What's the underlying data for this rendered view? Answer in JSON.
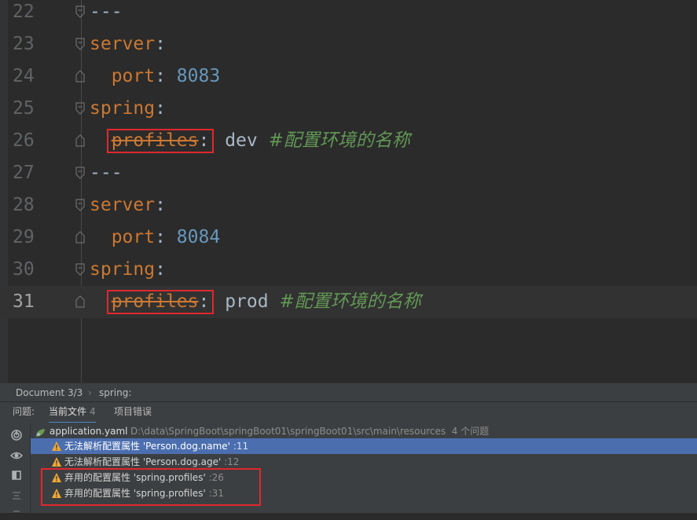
{
  "editor": {
    "lines": [
      {
        "num": "22",
        "indent": "",
        "tokens": [
          {
            "t": "---",
            "c": "p"
          }
        ]
      },
      {
        "num": "23",
        "indent": "",
        "tokens": [
          {
            "t": "server",
            "c": "k"
          },
          {
            "t": ":",
            "c": "p"
          }
        ]
      },
      {
        "num": "24",
        "indent": "  ",
        "tokens": [
          {
            "t": "port",
            "c": "k"
          },
          {
            "t": ": ",
            "c": "p"
          },
          {
            "t": "8083",
            "c": "n"
          }
        ]
      },
      {
        "num": "25",
        "indent": "",
        "tokens": [
          {
            "t": "spring",
            "c": "k"
          },
          {
            "t": ":",
            "c": "p"
          }
        ]
      },
      {
        "num": "26",
        "indent": "  ",
        "tokens": [
          {
            "t": "profiles",
            "c": "k dep",
            "box": "start"
          },
          {
            "t": ":",
            "c": "p",
            "box": "end"
          },
          {
            "t": " dev ",
            "c": "v"
          },
          {
            "t": "#配置环境的名称",
            "c": "c"
          }
        ]
      },
      {
        "num": "27",
        "indent": "",
        "tokens": [
          {
            "t": "---",
            "c": "p"
          }
        ]
      },
      {
        "num": "28",
        "indent": "",
        "tokens": [
          {
            "t": "server",
            "c": "k"
          },
          {
            "t": ":",
            "c": "p"
          }
        ]
      },
      {
        "num": "29",
        "indent": "  ",
        "tokens": [
          {
            "t": "port",
            "c": "k"
          },
          {
            "t": ": ",
            "c": "p"
          },
          {
            "t": "8084",
            "c": "n"
          }
        ]
      },
      {
        "num": "30",
        "indent": "",
        "tokens": [
          {
            "t": "spring",
            "c": "k"
          },
          {
            "t": ":",
            "c": "p"
          }
        ]
      },
      {
        "num": "31",
        "indent": "  ",
        "current": true,
        "tokens": [
          {
            "t": "profiles",
            "c": "k dep",
            "box": "start"
          },
          {
            "t": ":",
            "c": "p",
            "box": "end"
          },
          {
            "t": " prod ",
            "c": "v"
          },
          {
            "t": "#配置环境的名称",
            "c": "c"
          }
        ]
      }
    ]
  },
  "breadcrumb": {
    "document": "Document 3/3",
    "path": "spring:"
  },
  "problems_tabs": {
    "label": "问题:",
    "current_file": "当前文件",
    "current_file_count": "4",
    "project_errors": "项目错误"
  },
  "problems": {
    "file_name": "application.yaml",
    "file_path": "D:\\data\\SpringBoot\\springBoot01\\springBoot01\\src\\main\\resources",
    "file_count": "4 个问题",
    "items": [
      {
        "text": "无法解析配置属性 'Person.dog.name'",
        "line": ":11"
      },
      {
        "text": "无法解析配置属性 'Person.dog.age'",
        "line": ":12"
      },
      {
        "text": "弃用的配置属性 'spring.profiles'",
        "line": ":26"
      },
      {
        "text": "弃用的配置属性 'spring.profiles'",
        "line": ":31"
      }
    ]
  },
  "colors": {
    "keyword": "#cc7832",
    "number": "#6897bb",
    "comment": "#629755",
    "highlight": "#e0282e",
    "selection": "#4b6eaf"
  },
  "icons": [
    "fold-marker-icon",
    "spring-leaf-icon",
    "warning-icon",
    "problems-sync-icon",
    "eye-icon",
    "preview-icon",
    "collapse-icon"
  ]
}
